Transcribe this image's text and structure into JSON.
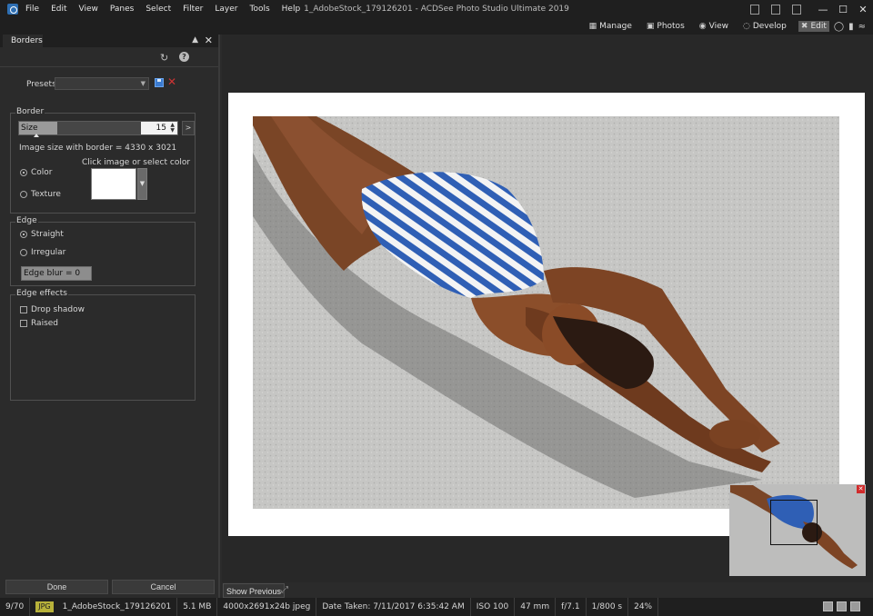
{
  "menu": {
    "items": [
      "File",
      "Edit",
      "View",
      "Panes",
      "Select",
      "Filter",
      "Layer",
      "Tools",
      "Help"
    ]
  },
  "window": {
    "title": "1_AdobeStock_179126201 - ACDSee Photo Studio Ultimate 2019"
  },
  "modes": {
    "items": [
      {
        "label": "Manage",
        "icon": "grid-icon"
      },
      {
        "label": "Photos",
        "icon": "photos-icon"
      },
      {
        "label": "View",
        "icon": "eye-icon"
      },
      {
        "label": "Develop",
        "icon": "develop-icon"
      },
      {
        "label": "Edit",
        "icon": "edit-icon",
        "active": true
      }
    ],
    "extras": [
      "360-icon",
      "histogram-icon",
      "wave-icon"
    ]
  },
  "panel": {
    "tab": "Borders",
    "presets_label": "Presets",
    "presets_value": "",
    "border": {
      "legend": "Border",
      "size_label": "Size",
      "size_value": "15",
      "size_fraction": 0.08,
      "image_size": "Image size with border = 4330 x 3021",
      "click_hint": "Click image or select color",
      "color_label": "Color",
      "texture_label": "Texture",
      "fill_mode": "color",
      "swatch_color": "#ffffff"
    },
    "edge": {
      "legend": "Edge",
      "straight_label": "Straight",
      "irregular_label": "Irregular",
      "mode": "straight",
      "blur_label": "Edge blur = 0"
    },
    "effects": {
      "legend": "Edge effects",
      "drop_shadow_label": "Drop shadow",
      "raised_label": "Raised"
    },
    "done_label": "Done",
    "cancel_label": "Cancel"
  },
  "canvas": {
    "show_previous_label": "Show Previous",
    "border_color": "#ffffff"
  },
  "status": {
    "index": "9/70",
    "format": "JPG",
    "filename": "1_AdobeStock_179126201",
    "filesize": "5.1 MB",
    "dimensions": "4000x2691x24b jpeg",
    "date_taken": "Date Taken: 7/11/2017 6:35:42 AM",
    "iso": "ISO 100",
    "focal": "47 mm",
    "aperture": "f/7.1",
    "shutter": "1/800 s",
    "zoom": "24%"
  }
}
